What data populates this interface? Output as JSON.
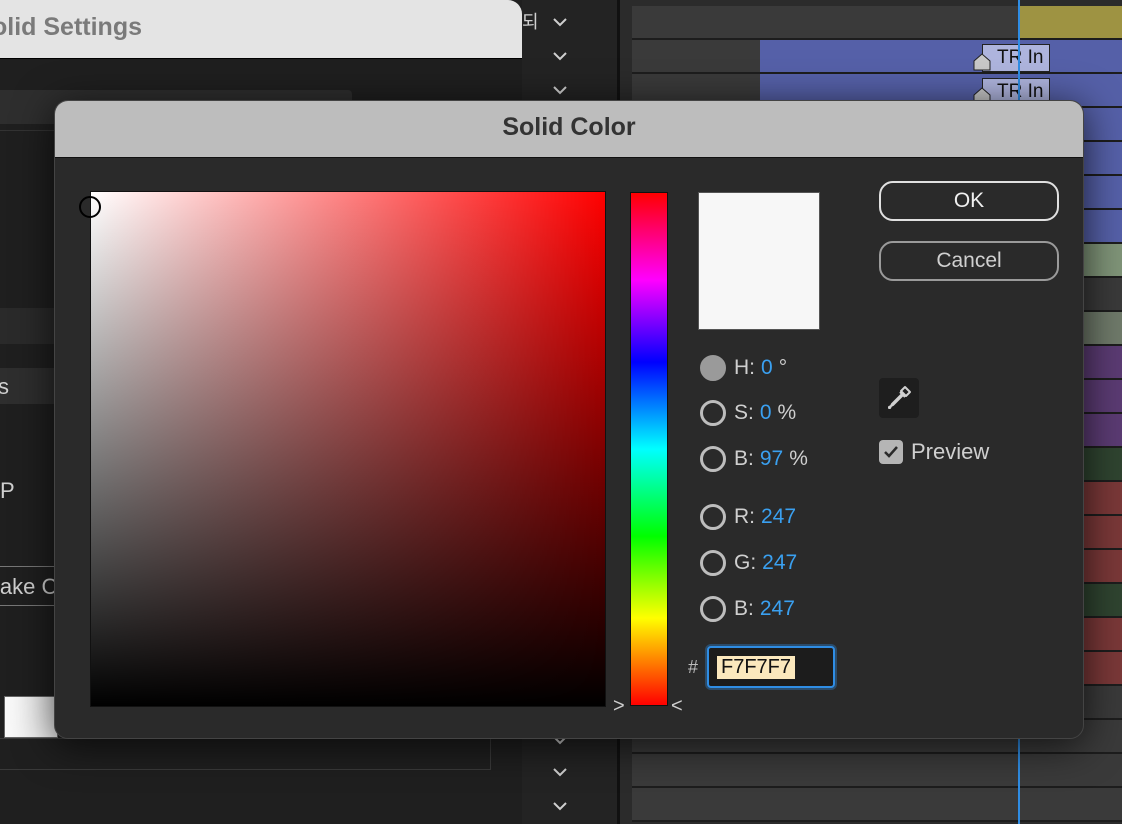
{
  "background": {
    "solid_settings": {
      "title": "olid Settings",
      "labels": [
        "s",
        "P",
        "lake C"
      ]
    },
    "timeline": {
      "korean_label": "되",
      "markers": [
        "TR In",
        "TR In"
      ]
    }
  },
  "dialog": {
    "title": "Solid Color",
    "hsb": {
      "h_label": "H:",
      "h_value": "0",
      "h_unit": "°",
      "s_label": "S:",
      "s_value": "0",
      "s_unit": "%",
      "b_label": "B:",
      "b_value": "97",
      "b_unit": "%"
    },
    "rgb": {
      "r_label": "R:",
      "r_value": "247",
      "g_label": "G:",
      "g_value": "247",
      "b_label": "B:",
      "b_value": "247"
    },
    "hex_prefix": "#",
    "hex_value": "F7F7F7",
    "ok_label": "OK",
    "cancel_label": "Cancel",
    "preview_label": "Preview",
    "hue_left_arrow": ">",
    "hue_right_arrow": "<",
    "current_color": "#F7F7F7",
    "accent_color": "#3aa0f0"
  }
}
